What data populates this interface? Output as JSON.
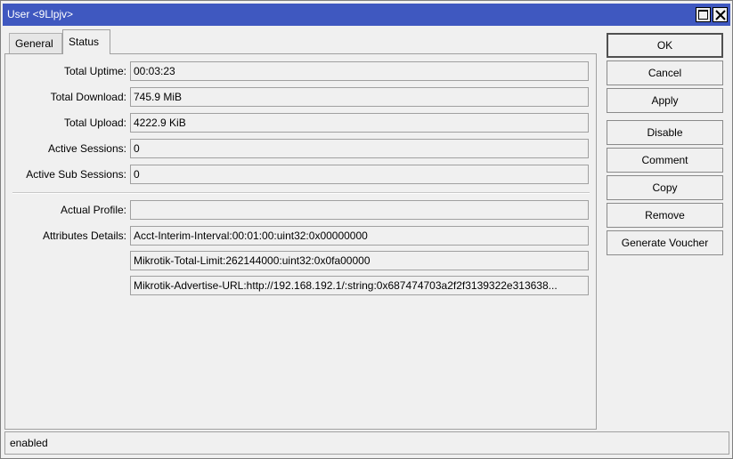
{
  "window": {
    "title": "User <9Llpjv>"
  },
  "tabs": [
    {
      "label": "General"
    },
    {
      "label": "Status"
    }
  ],
  "fields": {
    "total_uptime": {
      "label": "Total Uptime:",
      "value": "00:03:23"
    },
    "total_download": {
      "label": "Total Download:",
      "value": "745.9 MiB"
    },
    "total_upload": {
      "label": "Total Upload:",
      "value": "4222.9 KiB"
    },
    "active_sessions": {
      "label": "Active Sessions:",
      "value": "0"
    },
    "active_sub_sessions": {
      "label": "Active Sub Sessions:",
      "value": "0"
    },
    "actual_profile": {
      "label": "Actual Profile:",
      "value": ""
    },
    "attributes_details": {
      "label": "Attributes Details:",
      "values": [
        "Acct-Interim-Interval:00:01:00:uint32:0x00000000",
        "Mikrotik-Total-Limit:262144000:uint32:0x0fa00000",
        "Mikrotik-Advertise-URL:http://192.168.192.1/:string:0x687474703a2f2f3139322e313638..."
      ]
    }
  },
  "buttons": {
    "ok": "OK",
    "cancel": "Cancel",
    "apply": "Apply",
    "disable": "Disable",
    "comment": "Comment",
    "copy": "Copy",
    "remove": "Remove",
    "generate_voucher": "Generate Voucher"
  },
  "status_bar": {
    "text": "enabled"
  },
  "colors": {
    "titlebar": "#3f58c0",
    "background": "#f0f0f0"
  }
}
